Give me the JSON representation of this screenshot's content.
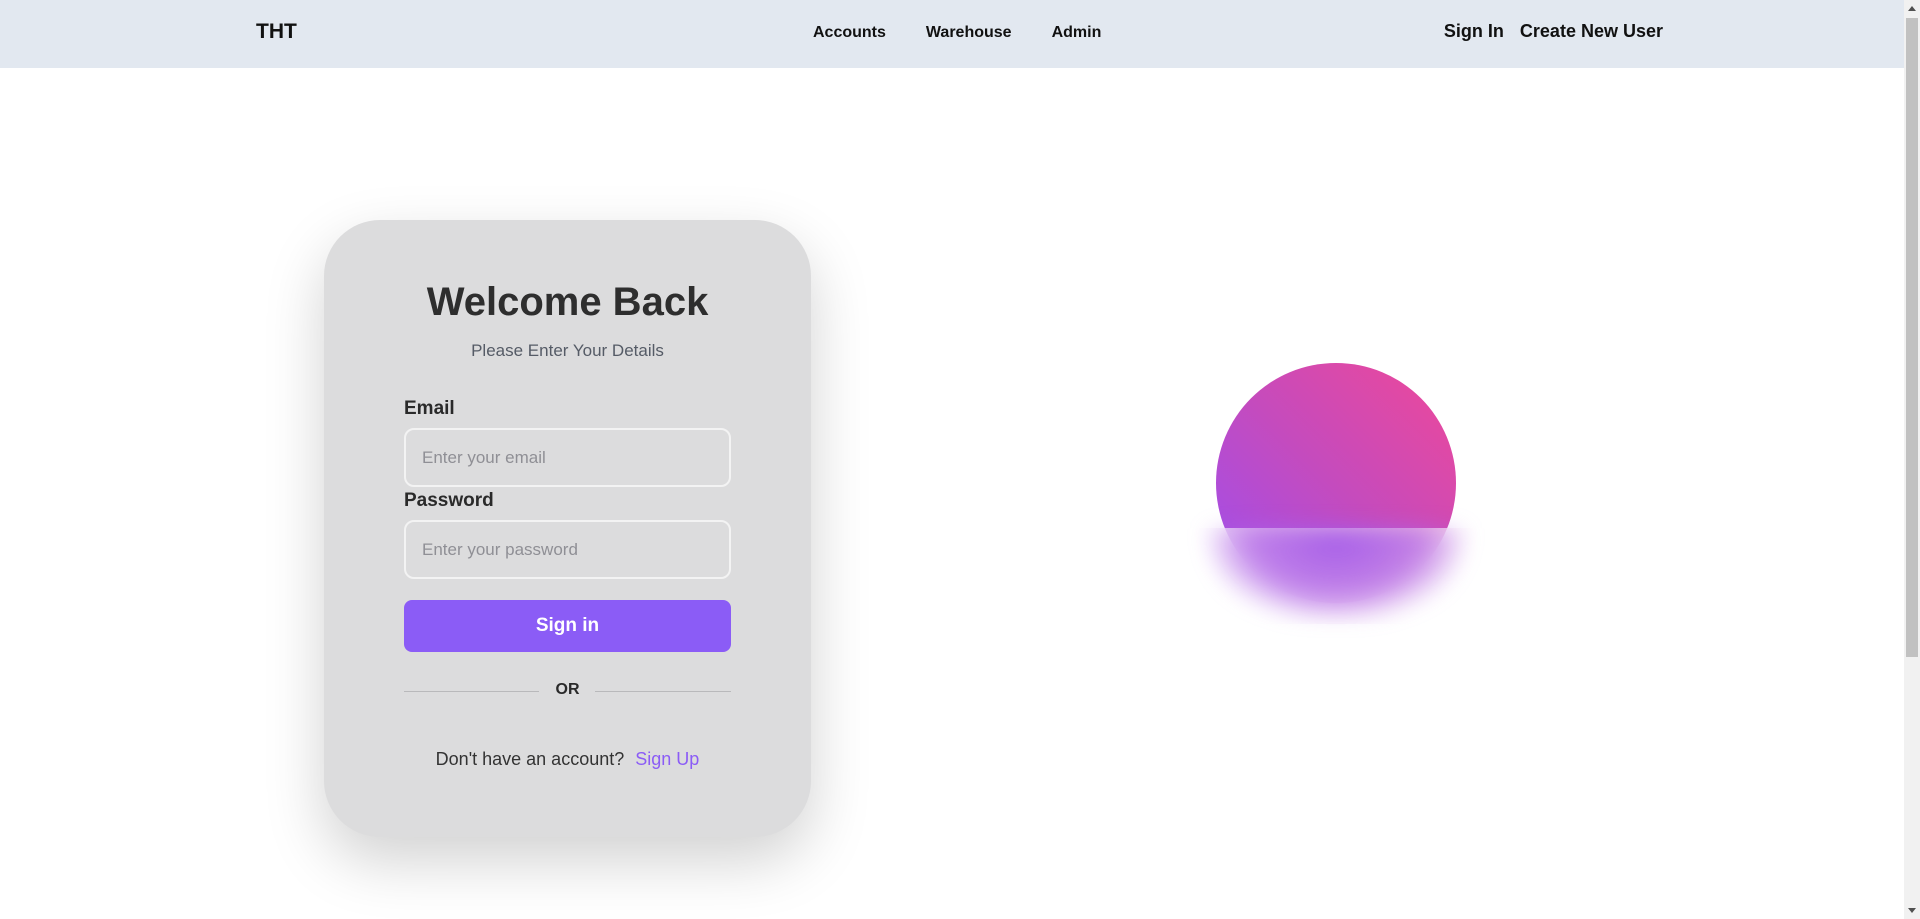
{
  "navbar": {
    "brand": "THT",
    "links": [
      "Accounts",
      "Warehouse",
      "Admin"
    ],
    "sign_in": "Sign In",
    "create_user": "Create New User",
    "background": "#e2e8f0"
  },
  "login_card": {
    "title": "Welcome Back",
    "subtitle": "Please Enter Your Details",
    "email_label": "Email",
    "email_placeholder": "Enter your email",
    "email_value": "",
    "password_label": "Password",
    "password_placeholder": "Enter your password",
    "password_value": "",
    "signin_button": "Sign in",
    "divider_text": "OR",
    "signup_prompt": "Don't have an account?",
    "signup_link": "Sign Up",
    "accent_color": "#8b5cf6",
    "card_color": "#dcdcdd"
  },
  "decoration": {
    "sphere_gradient": [
      "#9c4ff0",
      "#c54bbd",
      "#ef4898"
    ]
  }
}
